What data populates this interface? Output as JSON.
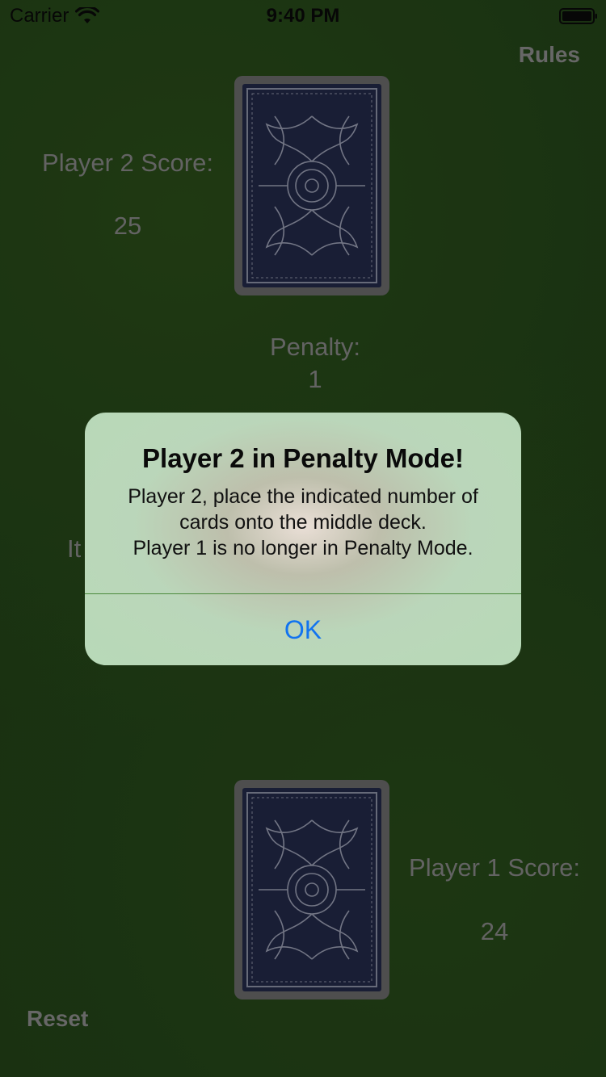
{
  "status_bar": {
    "carrier": "Carrier",
    "time": "9:40 PM",
    "icons": [
      "wifi-icon",
      "battery-icon"
    ]
  },
  "header": {
    "rules_label": "Rules"
  },
  "player2": {
    "score_label": "Player 2 Score:",
    "score_value": "25"
  },
  "penalty": {
    "label": "Penalty:",
    "value": "1"
  },
  "obscured_label_fragment": "It",
  "player1": {
    "score_label": "Player 1 Score:",
    "score_value": "24"
  },
  "footer": {
    "reset_label": "Reset"
  },
  "alert": {
    "title": "Player 2 in Penalty Mode!",
    "message_lines": [
      "Player 2, place the indicated number of",
      "cards onto the middle deck.",
      "Player 1 is no longer in Penalty Mode."
    ],
    "ok_label": "OK"
  },
  "colors": {
    "felt": "#234418",
    "muted_text": "#8a8a8a",
    "card_border": "#6c6c6c",
    "card_back": "#232a4a",
    "alert_button": "#1173f0"
  }
}
